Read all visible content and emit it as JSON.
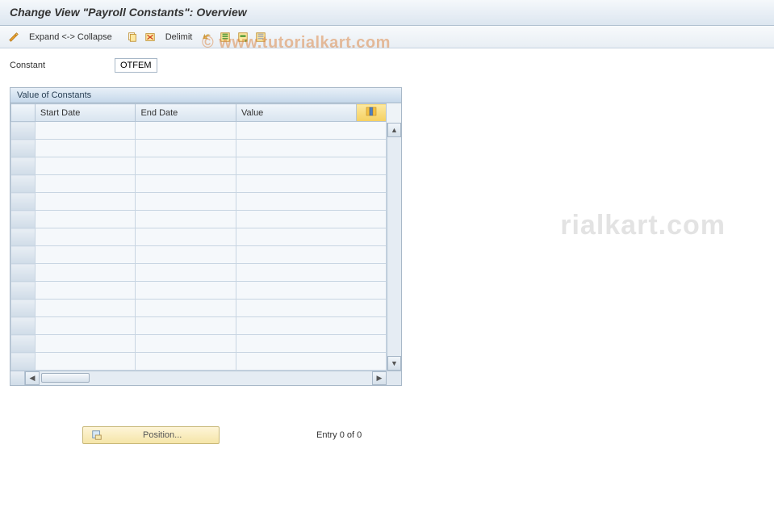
{
  "title": "Change View \"Payroll Constants\": Overview",
  "toolbar": {
    "expand_collapse": "Expand <-> Collapse",
    "delimit": "Delimit"
  },
  "field": {
    "constant_label": "Constant",
    "constant_value": "OTFEM"
  },
  "panel": {
    "title": "Value of Constants",
    "columns": {
      "start_date": "Start Date",
      "end_date": "End Date",
      "value": "Value"
    },
    "rows": [
      {
        "start": "",
        "end": "",
        "value": ""
      },
      {
        "start": "",
        "end": "",
        "value": ""
      },
      {
        "start": "",
        "end": "",
        "value": ""
      },
      {
        "start": "",
        "end": "",
        "value": ""
      },
      {
        "start": "",
        "end": "",
        "value": ""
      },
      {
        "start": "",
        "end": "",
        "value": ""
      },
      {
        "start": "",
        "end": "",
        "value": ""
      },
      {
        "start": "",
        "end": "",
        "value": ""
      },
      {
        "start": "",
        "end": "",
        "value": ""
      },
      {
        "start": "",
        "end": "",
        "value": ""
      },
      {
        "start": "",
        "end": "",
        "value": ""
      },
      {
        "start": "",
        "end": "",
        "value": ""
      },
      {
        "start": "",
        "end": "",
        "value": ""
      },
      {
        "start": "",
        "end": "",
        "value": ""
      }
    ]
  },
  "footer": {
    "position_label": "Position...",
    "entry_status": "Entry 0 of 0"
  },
  "watermark": {
    "top": "© www.tutorialkart.com",
    "side": "rialkart.com"
  }
}
